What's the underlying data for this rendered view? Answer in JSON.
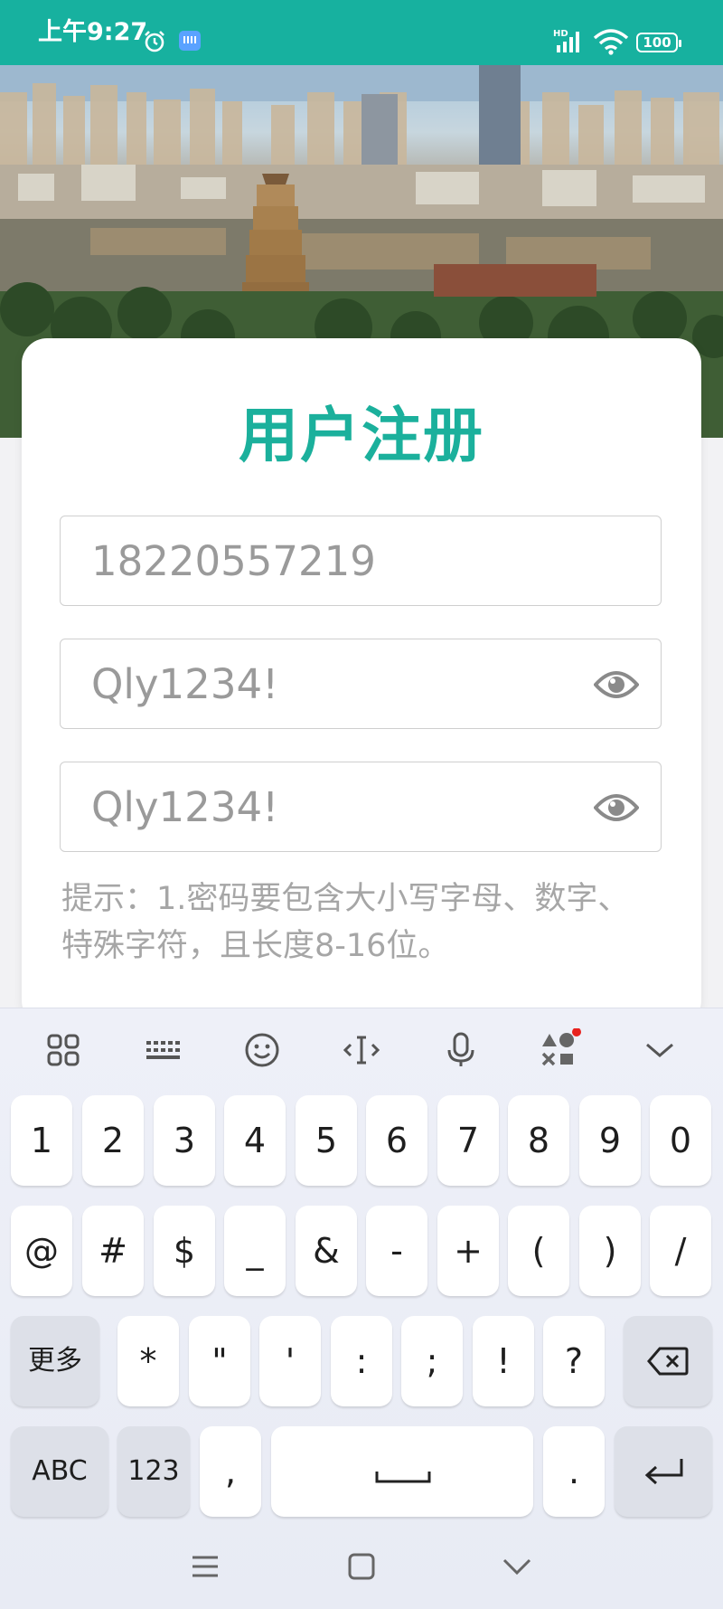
{
  "status_bar": {
    "time": "上午9:27",
    "battery": "100",
    "network": "HD"
  },
  "form": {
    "title": "用户注册",
    "phone_value": "18220557219",
    "password_value": "Qly1234!",
    "confirm_password_value": "Qly1234!",
    "hint": "提示：1.密码要包含大小写字母、数字、特殊字符，且长度8-16位。"
  },
  "keyboard": {
    "toolbar_icons": [
      "apps-icon",
      "keyboard-icon",
      "emoji-icon",
      "cursor-icon",
      "microphone-icon",
      "ai-shapes-icon",
      "collapse-icon"
    ],
    "row1": [
      "1",
      "2",
      "3",
      "4",
      "5",
      "6",
      "7",
      "8",
      "9",
      "0"
    ],
    "row2": [
      "@",
      "#",
      "$",
      "_",
      "&",
      "-",
      "+",
      "(",
      ")",
      "/"
    ],
    "row3": [
      "更多",
      "*",
      "\"",
      "'",
      ":",
      ";",
      "!",
      "?"
    ],
    "row4": [
      "ABC",
      "123",
      ",",
      "."
    ]
  },
  "colors": {
    "accent": "#17b19f",
    "title": "#1bb09c"
  }
}
